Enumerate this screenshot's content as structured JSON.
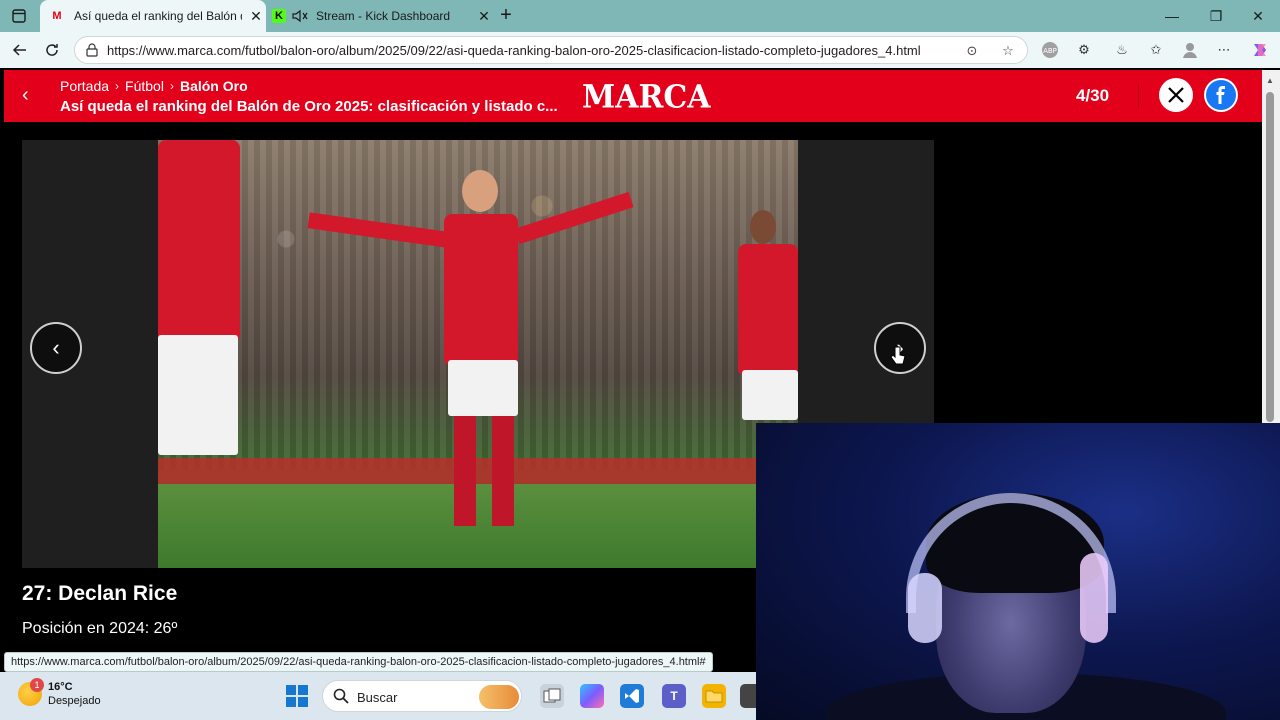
{
  "browser": {
    "tabs": [
      {
        "title": "Así queda el ranking del Balón de Oro",
        "favicon": "M",
        "active": true
      },
      {
        "title": "Stream - Kick Dashboard",
        "favicon": "K",
        "active": false
      }
    ],
    "url": "https://www.marca.com/futbol/balon-oro/album/2025/09/22/asi-queda-ranking-balon-oro-2025-clasificacion-listado-completo-jugadores_4.html",
    "status_url": "https://www.marca.com/futbol/balon-oro/album/2025/09/22/asi-queda-ranking-balon-oro-2025-clasificacion-listado-completo-jugadores_4.html#"
  },
  "header": {
    "breadcrumbs": [
      "Portada",
      "Fútbol",
      "Balón Oro"
    ],
    "title": "Así queda el ranking del Balón de Oro 2025: clasificación y listado c...",
    "logo": "MARCA",
    "counter": "4/30",
    "social": [
      "X",
      "f"
    ]
  },
  "gallery": {
    "caption_title": "27: Declan Rice",
    "caption_sub": "Posición en 2024: 26º",
    "prev": "‹",
    "next": "›"
  },
  "taskbar": {
    "weather_temp": "16°C",
    "weather_desc": "Despejado",
    "weather_badge": "1",
    "search_label": "Buscar"
  },
  "colors": {
    "marca_red": "#e2001a",
    "tabstrip": "#7fb7b7",
    "toolbar": "#eef7f7",
    "taskbar": "#dbe6ee"
  }
}
